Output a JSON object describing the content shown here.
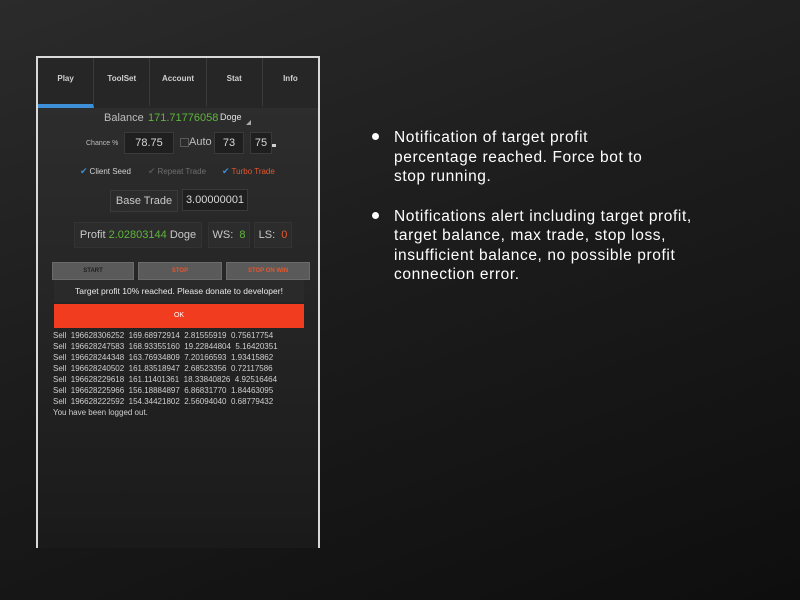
{
  "tabs": [
    {
      "label": "Play",
      "active": true
    },
    {
      "label": "ToolSet"
    },
    {
      "label": "Account"
    },
    {
      "label": "Stat"
    },
    {
      "label": "Info"
    }
  ],
  "balance": {
    "label": "Balance",
    "value": "171.71776058",
    "coin": "Doge"
  },
  "chance": {
    "label": "Chance %",
    "value": "78.75",
    "auto_label": "Auto",
    "min": "73",
    "max": "75"
  },
  "options": {
    "client_seed": "Client Seed",
    "repeat_trade": "Repeat Trade",
    "turbo_trade": "Turbo Trade"
  },
  "base_trade": {
    "label": "Base Trade",
    "value": "3.00000001"
  },
  "profit": {
    "label": "Profit",
    "value": "2.02803144",
    "coin": "Doge"
  },
  "ws": {
    "label": "WS:",
    "value": "8"
  },
  "ls": {
    "label": "LS:",
    "value": "0"
  },
  "controls": {
    "start": "START",
    "stop": "STOP",
    "stop_on_win": "STOP ON WIN"
  },
  "dialog": {
    "message": "Target profit 10%  reached. Please donate to developer!",
    "ok": "OK"
  },
  "log": [
    "Sell  196628306252  169.68972914  2.81555919  0.75617754",
    "Sell  196628247583  168.93355160  19.22844804  5.16420351",
    "Sell  196628244348  163.76934809  7.20166593  1.93415862",
    "Sell  196628240502  161.83518947  2.68523356  0.72117586",
    "Sell  196628229618  161.11401361  18.33840826  4.92516464",
    "Sell  196628225966  156.18884897  6.86831770  1.84463095",
    "Sell  196628222592  154.34421802  2.56094040  0.68779432",
    "You have been logged out."
  ],
  "notes": [
    "Notification of target profit\npercentage reached.  Force bot to\nstop running.",
    "Notifications alert including target profit,\ntarget balance, max trade, stop loss,\ninsufficient balance, no possible profit\nconnection error."
  ],
  "colors": {
    "accent": "#3d8fd8",
    "profit_green": "#5fb53c",
    "alert_red": "#f13c1f"
  }
}
